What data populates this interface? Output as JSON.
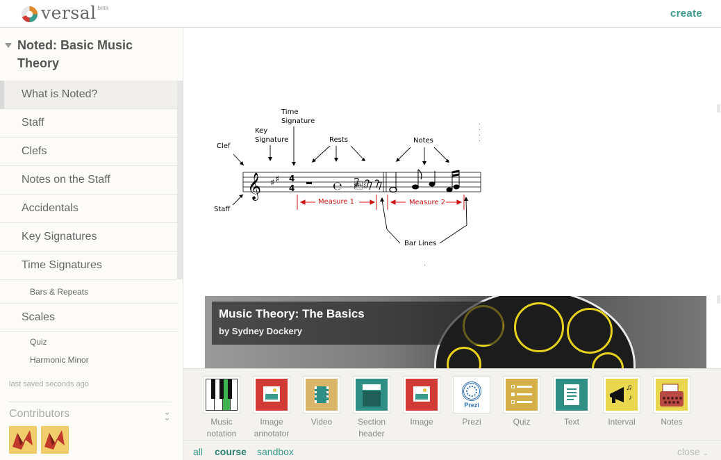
{
  "header": {
    "brand": "versal",
    "beta": "beta",
    "create_label": "create"
  },
  "sidebar": {
    "course_title": "Noted: Basic Music Theory",
    "items": [
      {
        "label": "What is Noted?"
      },
      {
        "label": "Staff"
      },
      {
        "label": "Clefs"
      },
      {
        "label": "Notes on the Staff"
      },
      {
        "label": "Accidentals"
      },
      {
        "label": "Key Signatures"
      },
      {
        "label": "Time Signatures"
      },
      {
        "label": "Bars & Repeats"
      },
      {
        "label": "Scales"
      },
      {
        "label": "Quiz"
      },
      {
        "label": "Harmonic Minor"
      }
    ],
    "saved_status": "last saved seconds ago",
    "contributors_title": "Contributors"
  },
  "diagram": {
    "labels": {
      "clef": "Clef",
      "staff": "Staff",
      "key_signature_1": "Key",
      "key_signature_2": "Signature",
      "time_signature_1": "Time",
      "time_signature_2": "Signature",
      "rests": "Rests",
      "notes": "Notes",
      "measure_1": "Measure 1",
      "measure_2": "Measure 2",
      "bar_lines": "Bar Lines"
    },
    "colors": {
      "measure": "#cc1111",
      "ink": "#000000"
    }
  },
  "embed": {
    "title": "Music Theory: The Basics",
    "byline": "by Sydney Dockery"
  },
  "gadgets": [
    {
      "label_1": "Music",
      "label_2": "notation",
      "icon": "piano-keys-icon"
    },
    {
      "label_1": "Image",
      "label_2": "annotator",
      "icon": "image-annotator-icon"
    },
    {
      "label_1": "Video",
      "label_2": "",
      "icon": "video-icon"
    },
    {
      "label_1": "Section",
      "label_2": "header",
      "icon": "section-header-icon"
    },
    {
      "label_1": "Image",
      "label_2": "",
      "icon": "image-icon"
    },
    {
      "label_1": "Prezi",
      "label_2": "",
      "icon": "prezi-icon",
      "icon_text": "Prezi"
    },
    {
      "label_1": "Quiz",
      "label_2": "",
      "icon": "quiz-icon"
    },
    {
      "label_1": "Text",
      "label_2": "",
      "icon": "text-doc-icon"
    },
    {
      "label_1": "Interval",
      "label_2": "",
      "icon": "megaphone-icon"
    },
    {
      "label_1": "Notes",
      "label_2": "",
      "icon": "typewriter-icon"
    }
  ],
  "tray_tabs": {
    "all": "all",
    "course": "course",
    "sandbox": "sandbox",
    "close": "close"
  },
  "theme": {
    "accent": "#3a9a8c",
    "image_red": "#d23a36",
    "teal": "#2f8f84",
    "gold": "#d5b048",
    "interval_yellow": "#e9d84e"
  }
}
